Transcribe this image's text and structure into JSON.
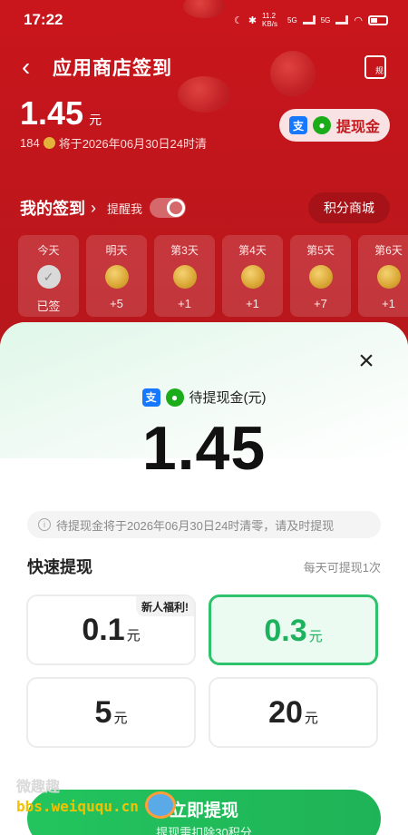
{
  "status_bar": {
    "time": "17:22",
    "net_speed": "11.2 KB/s",
    "signal_labels": [
      "5G",
      "5G"
    ]
  },
  "nav": {
    "title": "应用商店签到",
    "rules_icon_text": "规"
  },
  "balance": {
    "amount": "1.45",
    "unit": "元",
    "cash_button": "提现金",
    "points": "184",
    "expiry_text": "将于2026年06月30日24时清"
  },
  "my_sign": {
    "title": "我的签到",
    "remind_label": "提醒我",
    "mall_button": "积分商城"
  },
  "days": [
    {
      "label": "今天",
      "reward": "已签",
      "signed": true
    },
    {
      "label": "明天",
      "reward": "+5",
      "signed": false
    },
    {
      "label": "第3天",
      "reward": "+1",
      "signed": false
    },
    {
      "label": "第4天",
      "reward": "+1",
      "signed": false
    },
    {
      "label": "第5天",
      "reward": "+7",
      "signed": false
    },
    {
      "label": "第6天",
      "reward": "+1",
      "signed": false
    }
  ],
  "modal": {
    "pending_label": "待提现金(元)",
    "amount": "1.45",
    "notice": "待提现金将于2026年06月30日24时清零，请及时提现",
    "quick_title": "快速提现",
    "quick_note": "每天可提现1次",
    "options": [
      {
        "value": "0.1",
        "unit": "元",
        "tag": "新人福利!",
        "selected": false
      },
      {
        "value": "0.3",
        "unit": "元",
        "tag": "",
        "selected": true
      },
      {
        "value": "5",
        "unit": "元",
        "tag": "",
        "selected": false
      },
      {
        "value": "20",
        "unit": "元",
        "tag": "",
        "selected": false
      }
    ],
    "submit_label": "立即提现",
    "submit_sub": "提现需扣除30积分"
  },
  "watermark": {
    "name": "微趣趣",
    "url": "bbs.weiququ.cn"
  },
  "colors": {
    "primary_red": "#c9161c",
    "accent_green": "#2fc26c",
    "alipay_blue": "#1677ff",
    "wechat_green": "#1aad19"
  }
}
